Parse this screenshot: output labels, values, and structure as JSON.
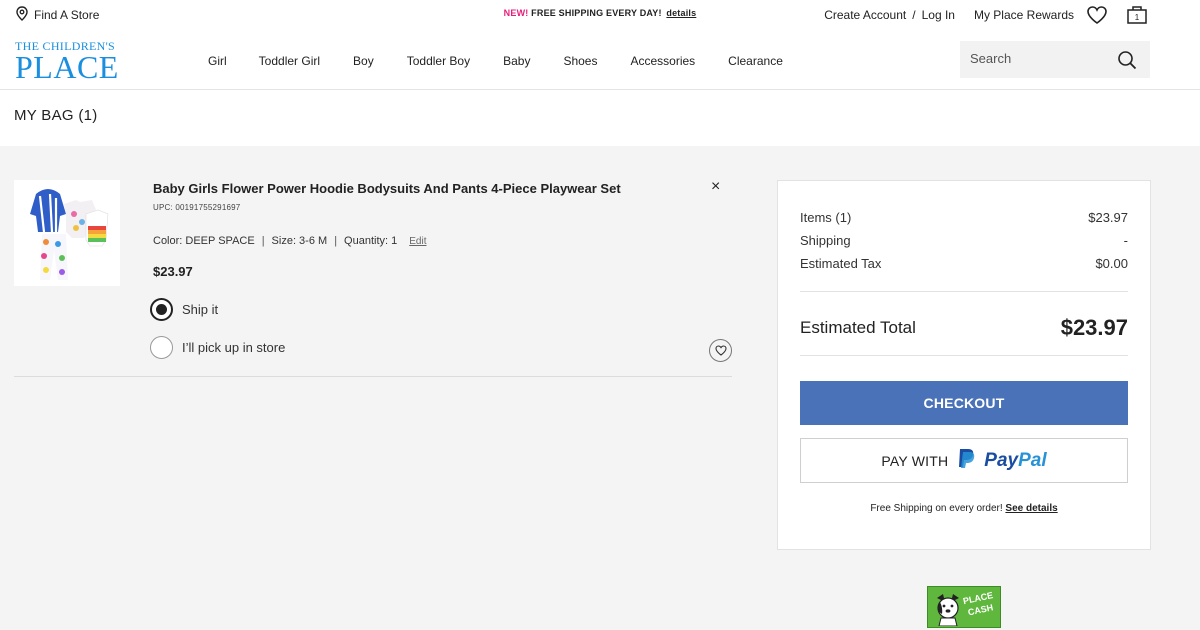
{
  "util_bar": {
    "find_store": "Find A Store",
    "promo_new": "NEW!",
    "promo_text": "FREE SHIPPING EVERY DAY!",
    "promo_details": "details",
    "create_account": "Create Account",
    "separator": "/",
    "log_in": "Log In",
    "rewards": "My Place Rewards",
    "bag_count": "1"
  },
  "header": {
    "logo_line1": "THE CHILDREN'S",
    "logo_line2": "PLACE",
    "nav": [
      "Girl",
      "Toddler Girl",
      "Boy",
      "Toddler Boy",
      "Baby",
      "Shoes",
      "Accessories",
      "Clearance"
    ],
    "search_placeholder": "Search"
  },
  "bag": {
    "title": "MY BAG (1)"
  },
  "item": {
    "title": "Baby Girls Flower Power Hoodie Bodysuits And Pants 4-Piece Playwear Set",
    "upc": "UPC: 00191755291697",
    "color": "Color: DEEP SPACE",
    "size": "Size: 3-6 M",
    "quantity": "Quantity: 1",
    "attr_separator": "|",
    "edit": "Edit",
    "price": "$23.97",
    "remove": "×",
    "ship_option": "Ship it",
    "pickup_option": "I’ll pick up in store",
    "ship_selected": true
  },
  "summary": {
    "items_label": "Items (1)",
    "items_value": "$23.97",
    "shipping_label": "Shipping",
    "shipping_value": "-",
    "tax_label": "Estimated Tax",
    "tax_value": "$0.00",
    "total_label": "Estimated Total",
    "total_value": "$23.97",
    "checkout": "CHECKOUT",
    "pay_with": "PAY WITH",
    "paypal_pay": "Pay",
    "paypal_pal": "Pal",
    "free_ship_text": "Free Shipping on every order!",
    "free_ship_link": "See details"
  },
  "badge": {
    "line1": "PLACE",
    "line2": "CASH"
  },
  "colors": {
    "accent_pink": "#e6207a",
    "logo_blue": "#1a8fe0",
    "checkout_blue": "#4a72b8",
    "paypal_dark": "#1a4da1",
    "paypal_light": "#2793d6",
    "place_cash_green": "#5fb83d"
  },
  "icons": {
    "store": "map-pin-icon",
    "wishlist": "heart-icon",
    "bag": "shopping-bag-icon",
    "search": "search-icon",
    "remove": "close-icon",
    "favorite": "heart-outline-icon",
    "paypal": "paypal-logo"
  }
}
